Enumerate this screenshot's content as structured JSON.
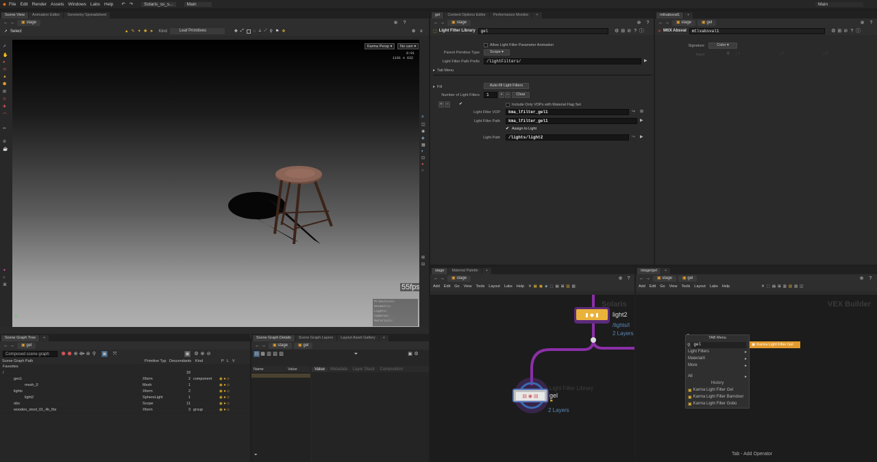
{
  "menubar": {
    "items": [
      "File",
      "Edit",
      "Render",
      "Assets",
      "Windows",
      "Labs",
      "Help"
    ],
    "desktop": "Solaris_ss_s...",
    "main": "Main",
    "right": "Main"
  },
  "scene_view": {
    "tabs": [
      "Scene View",
      "Animation Editor",
      "Geometry Spreadsheet"
    ],
    "path": "stage",
    "tool": "Select",
    "kind_label": "Kind",
    "kind_value": "Leaf Primitives",
    "renderer": "Karma Persp",
    "camera": "No cam",
    "hud_time": "0:01",
    "hud_res": "1191 x 632",
    "fps": "55fps",
    "stats": [
      "Primitives:",
      "Geometry:",
      "Lights:",
      "Cameras:",
      "Materials:"
    ]
  },
  "scene_graph": {
    "tabs": [
      "Scene Graph Tree"
    ],
    "path": "gel",
    "filter_placeholder": "Composed scene graph",
    "columns": [
      "Scene Graph Path",
      "Primitive Typ",
      "Descendants",
      "Kind",
      "P",
      "L",
      "V"
    ],
    "rows": [
      {
        "name": "Favorites",
        "type": "",
        "desc": "",
        "kind": "",
        "indent": 0
      },
      {
        "name": "/",
        "type": "",
        "desc": "18",
        "kind": "",
        "indent": 0
      },
      {
        "name": "geo1",
        "type": "Xform",
        "desc": "2",
        "kind": "component",
        "indent": 1
      },
      {
        "name": "mesh_0",
        "type": "Mesh",
        "desc": "1",
        "kind": "",
        "indent": 2
      },
      {
        "name": "lights",
        "type": "Xform",
        "desc": "2",
        "kind": "",
        "indent": 1
      },
      {
        "name": "light2",
        "type": "SphereLight",
        "desc": "1",
        "kind": "",
        "indent": 2
      },
      {
        "name": "obs",
        "type": "Scope",
        "desc": "11",
        "kind": "",
        "indent": 1
      },
      {
        "name": "wooden_stool_01_4k_fbx",
        "type": "Xform",
        "desc": "3",
        "kind": "group",
        "indent": 1
      }
    ]
  },
  "details": {
    "tabs": [
      "Scene Graph Details",
      "Scene Graph Layers",
      "Layout Asset Gallery"
    ],
    "path1": "stage",
    "path2": "gel",
    "cols": [
      "Name",
      "Value"
    ],
    "subtabs": [
      "Value",
      "Metadata",
      "Layer Stack",
      "Composition"
    ]
  },
  "params": {
    "tabs": [
      "gel",
      "Content Options Editor",
      "Performance Monitor"
    ],
    "path": "stage",
    "node_type": "Light Filter Library",
    "node_name": "gel",
    "allow_anim": "Allow Light Filter Parameter Animation",
    "parent_prim_label": "Parent Primitive Type",
    "parent_prim_value": "Scope",
    "path_prefix_label": "Light Filter Path Prefix",
    "path_prefix_value": "/lightFilters/",
    "tab_menu": "Tab Menu",
    "fill": "Fill",
    "autofill": "Auto-fill Light Filters",
    "num_label": "Number of Light Filters",
    "num_value": "1",
    "clear": "Clear",
    "include_only": "Include Only VOPs with Material Flag Set",
    "vop_label": "Light Filter VOP",
    "vop_value": "kma_lfilter_gel1",
    "lf_path_label": "Light Filter Path",
    "lf_path_value": "kma_lfilter_gel1",
    "assign": "Assign to Light",
    "light_path_label": "Light Path",
    "light_path_value": "/lights/light2"
  },
  "mtlx": {
    "tabs": [
      "mtlxabsval1"
    ],
    "path1": "stage",
    "path2": "gel",
    "node_type": "MtlX Absval",
    "node_name": "mtlxabsval1",
    "signature_label": "Signature",
    "signature_value": "Color",
    "input_label": "Input",
    "input_vals": [
      "0",
      "0",
      "0"
    ]
  },
  "network": {
    "tabs": [
      "stage",
      "Material Palette"
    ],
    "path": "stage",
    "menu": [
      "Add",
      "Edit",
      "Go",
      "View",
      "Tools",
      "Layout",
      "Labs",
      "Help"
    ],
    "watermark": "Solaris",
    "node1_name": "light2",
    "node1_sub1": "/lights/l",
    "node1_sub2": "2 Layers",
    "node2_type": "Light Filter Library",
    "node2_name": "gel",
    "node2_layers": "2 Layers"
  },
  "vex": {
    "tabs": [
      "/stage/gel"
    ],
    "path1": "stage",
    "path2": "gel",
    "menu": [
      "Add",
      "Edit",
      "Go",
      "View",
      "Tools",
      "Layout",
      "Labs",
      "Help"
    ],
    "watermark": "VEX Builder",
    "footer": "Tab - Add Operator",
    "tabmenu": {
      "title": "TAB Menu",
      "search": "gel",
      "items": [
        "Light Filters",
        "MaterialX",
        "More"
      ],
      "all": "All",
      "history_label": "History",
      "history": [
        "Karma Light Filter Gel",
        "Karma Light Filter Barndoor",
        "Karma Light Filter Gobo"
      ],
      "result": "Karma Light Filter Gel"
    }
  },
  "colors": {
    "accent": "#f0b020",
    "wire": "#8b2fa8",
    "node_yellow": "#e9b23a"
  }
}
